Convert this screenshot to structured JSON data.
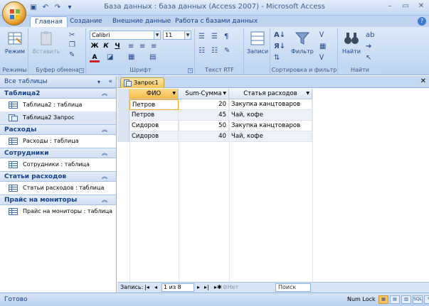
{
  "window": {
    "title": "База данных : база данных (Access 2007) - Microsoft Access"
  },
  "ribbon_tabs": [
    "Главная",
    "Создание",
    "Внешние данные",
    "Работа с базами данных"
  ],
  "ribbon": {
    "groups": {
      "modes": "Режимы",
      "clipboard": "Буфер обмена",
      "font": "Шрифт",
      "richtext": "Текст RTF",
      "records": "Записи",
      "sortfilter": "Сортировка и фильтр",
      "find": "Найти"
    },
    "buttons": {
      "view": "Режим",
      "paste": "Вставить",
      "records": "Записи",
      "filter": "Фильтр",
      "find": "Найти"
    },
    "font_name": "Calibri",
    "font_size": "11",
    "bold": "Ж",
    "italic": "К",
    "underline": "Ч",
    "font_color": "A"
  },
  "nav": {
    "header": "Все таблицы",
    "groups": [
      {
        "title": "Таблица2",
        "items": [
          "Таблица2 : таблица",
          "Таблица2 Запрос"
        ]
      },
      {
        "title": "Расходы",
        "items": [
          "Расходы : таблица"
        ]
      },
      {
        "title": "Сотрудники",
        "items": [
          "Сотрудники : таблица"
        ]
      },
      {
        "title": "Статьи расходов",
        "items": [
          "Статьи расходов : таблица"
        ]
      },
      {
        "title": "Прайс на мониторы",
        "items": [
          "Прайс на мониторы : таблица"
        ]
      }
    ]
  },
  "document": {
    "tab": "Запрос1",
    "columns": [
      "ФИО",
      "Sum-Сумма",
      "Статья расходов"
    ],
    "rows": [
      [
        "Петров",
        "20",
        "Закупка канцтоваров"
      ],
      [
        "Петров",
        "45",
        "Чай, кофе"
      ],
      [
        "Сидоров",
        "50",
        "Закупка канцтоваров"
      ],
      [
        "Сидоров",
        "40",
        "Чай, кофе"
      ]
    ],
    "record_nav": {
      "label": "Запись:",
      "position": "1 из 8",
      "filter": "Нет фильтра",
      "search": "Поиск"
    }
  },
  "status": {
    "left": "Готово",
    "numlock": "Num Lock"
  },
  "colors": {
    "accent": "#15428b",
    "active_tab": "#f7c35a",
    "ribbon_bg": "#c7daf3"
  }
}
